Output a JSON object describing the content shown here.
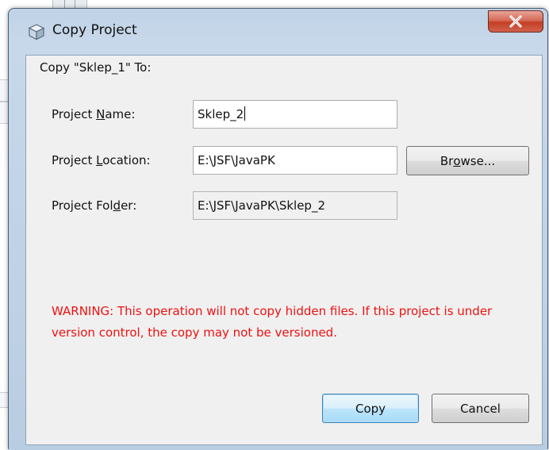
{
  "window": {
    "title": "Copy Project",
    "close_symbol": "X",
    "icon": "project-cube-icon"
  },
  "dialog": {
    "header": "Copy \"Sklep_1\" To:",
    "fields": {
      "name": {
        "label_pre": "Project ",
        "label_mnemonic": "N",
        "label_post": "ame:",
        "value": "Sklep_2"
      },
      "location": {
        "label_pre": "Project ",
        "label_mnemonic": "L",
        "label_post": "ocation:",
        "value": "E:\\JSF\\JavaPK"
      },
      "folder": {
        "label_pre": "Project Fol",
        "label_mnemonic": "d",
        "label_post": "er:",
        "value": "E:\\JSF\\JavaPK\\Sklep_2"
      }
    },
    "browse": {
      "pre": "Br",
      "mnemonic": "o",
      "post": "wse..."
    },
    "warning": "WARNING: This operation will not copy hidden files. If this project is under version control, the copy may not be versioned.",
    "buttons": {
      "copy": "Copy",
      "cancel": "Cancel"
    }
  },
  "colors": {
    "warning_text": "#ee1111",
    "client_bg": "#f0f0f0",
    "frame": "#c7d8ea",
    "close_button": "#c43f25"
  }
}
